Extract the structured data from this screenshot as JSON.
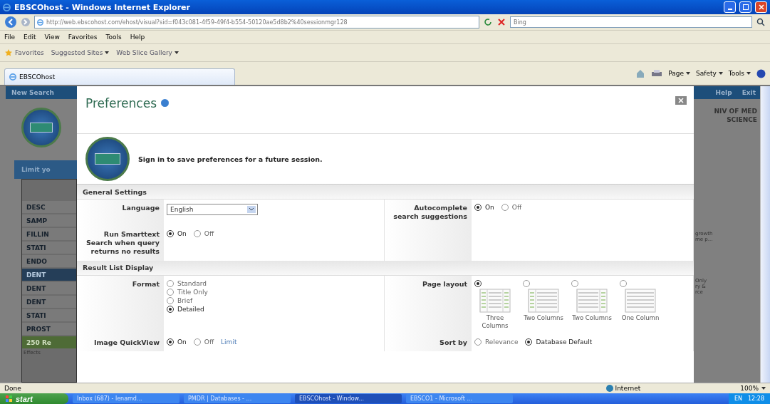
{
  "window": {
    "title": "EBSCOhost - Windows Internet Explorer"
  },
  "address_bar": {
    "url": "http://web.ebscohost.com/ehost/visual?sid=f043c081-4f59-49f4-b554-50120ae5d8b2%40sessionmgr128"
  },
  "search": {
    "placeholder": "Bing"
  },
  "menu": [
    "File",
    "Edit",
    "View",
    "Favorites",
    "Tools",
    "Help"
  ],
  "favorites_bar": {
    "label": "Favorites",
    "links": [
      "Suggested Sites",
      "Web Slice Gallery"
    ]
  },
  "tabs": [
    {
      "label": "EBSCOhost",
      "selected": true
    }
  ],
  "command_bar": [
    "Page",
    "Safety",
    "Tools"
  ],
  "background_page": {
    "top_link": "New Search",
    "header_links": [
      "Help",
      "Exit"
    ],
    "institution": "NIV OF MED SCIENCE",
    "limit_header": "Limit yo",
    "list": [
      {
        "label": "DESC",
        "selected": false
      },
      {
        "label": "SAMP",
        "selected": false
      },
      {
        "label": "FILLIN",
        "selected": false
      },
      {
        "label": "STATI",
        "selected": false
      },
      {
        "label": "ENDO",
        "selected": false
      },
      {
        "label": "DENT",
        "selected": true
      },
      {
        "label": "DENT",
        "selected": false
      },
      {
        "label": "DENT",
        "selected": false
      },
      {
        "label": "STATI",
        "selected": false
      },
      {
        "label": "PROST",
        "selected": false
      }
    ],
    "results_label": "250 Re",
    "result_snippet": "Effects",
    "right_snippets": [
      "growth",
      "me p...",
      "Only",
      "ry &",
      "rce"
    ]
  },
  "dialog": {
    "title": "Preferences",
    "sign_in": "Sign in to save preferences for a future session.",
    "sections": [
      {
        "title": "General Settings",
        "settings": [
          {
            "label": "Language",
            "kind": "select",
            "value": "English"
          },
          {
            "label": "Autocomplete search suggestions",
            "kind": "radio",
            "options": [
              {
                "label": "On",
                "selected": true
              },
              {
                "label": "Off",
                "selected": false
              }
            ]
          },
          {
            "label": "Run Smarttext Search when query returns no results",
            "kind": "radio",
            "options": [
              {
                "label": "On",
                "selected": true
              },
              {
                "label": "Off",
                "selected": false
              }
            ]
          }
        ]
      },
      {
        "title": "Result List Display",
        "settings": [
          {
            "label": "Format",
            "kind": "radio_list",
            "options": [
              {
                "label": "Standard",
                "selected": false
              },
              {
                "label": "Title Only",
                "selected": false
              },
              {
                "label": "Brief",
                "selected": false
              },
              {
                "label": "Detailed",
                "selected": true
              }
            ]
          },
          {
            "label": "Page layout",
            "kind": "layout",
            "options": [
              {
                "label": "Three Columns",
                "kind": "three",
                "selected": true
              },
              {
                "label": "Two Columns",
                "kind": "left",
                "selected": false
              },
              {
                "label": "Two Columns",
                "kind": "right",
                "selected": false
              },
              {
                "label": "One Column",
                "kind": "one",
                "selected": false
              }
            ]
          },
          {
            "label": "Image QuickView",
            "kind": "radio",
            "options": [
              {
                "label": "On",
                "selected": true
              },
              {
                "label": "Off",
                "selected": false
              }
            ],
            "link": "Limit"
          },
          {
            "label": "Sort by",
            "kind": "radio",
            "options": [
              {
                "label": "Relevance",
                "selected": false
              },
              {
                "label": "Database Default",
                "selected": true
              }
            ]
          }
        ]
      }
    ]
  },
  "status_bar": {
    "text": "Done",
    "zone": "Internet",
    "zoom": "100%"
  },
  "taskbar": {
    "start": "start",
    "items": [
      {
        "label": "Inbox (687) - lenamd...",
        "selected": false
      },
      {
        "label": "PMDR | Databases - ...",
        "selected": false
      },
      {
        "label": "EBSCOhost - Window...",
        "selected": true
      },
      {
        "label": "EBSCO1 - Microsoft ...",
        "selected": false
      }
    ],
    "language": "EN",
    "clock": "12:28"
  }
}
